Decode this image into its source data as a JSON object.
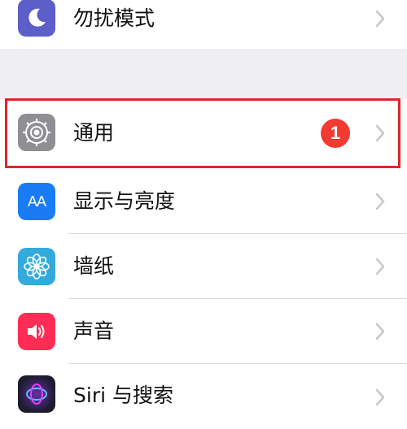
{
  "settings": {
    "items": [
      {
        "label": "勿扰模式",
        "icon": "moon-icon",
        "color": "#5b5fc7"
      },
      {
        "label": "通用",
        "icon": "gear-icon",
        "color": "#8e8e93",
        "badge": "1"
      },
      {
        "label": "显示与亮度",
        "icon": "text-size-icon",
        "color": "#1a7cf5",
        "icon_text": "AA"
      },
      {
        "label": "墙纸",
        "icon": "flower-icon",
        "color": "#34aadc"
      },
      {
        "label": "声音",
        "icon": "speaker-icon",
        "color": "#ff2d55"
      },
      {
        "label": "Siri 与搜索",
        "icon": "siri-icon",
        "color": "#1c1c2e"
      }
    ]
  },
  "colors": {
    "highlight": "#e1252a",
    "badge": "#f13a30",
    "group_background": "#efeff4"
  }
}
